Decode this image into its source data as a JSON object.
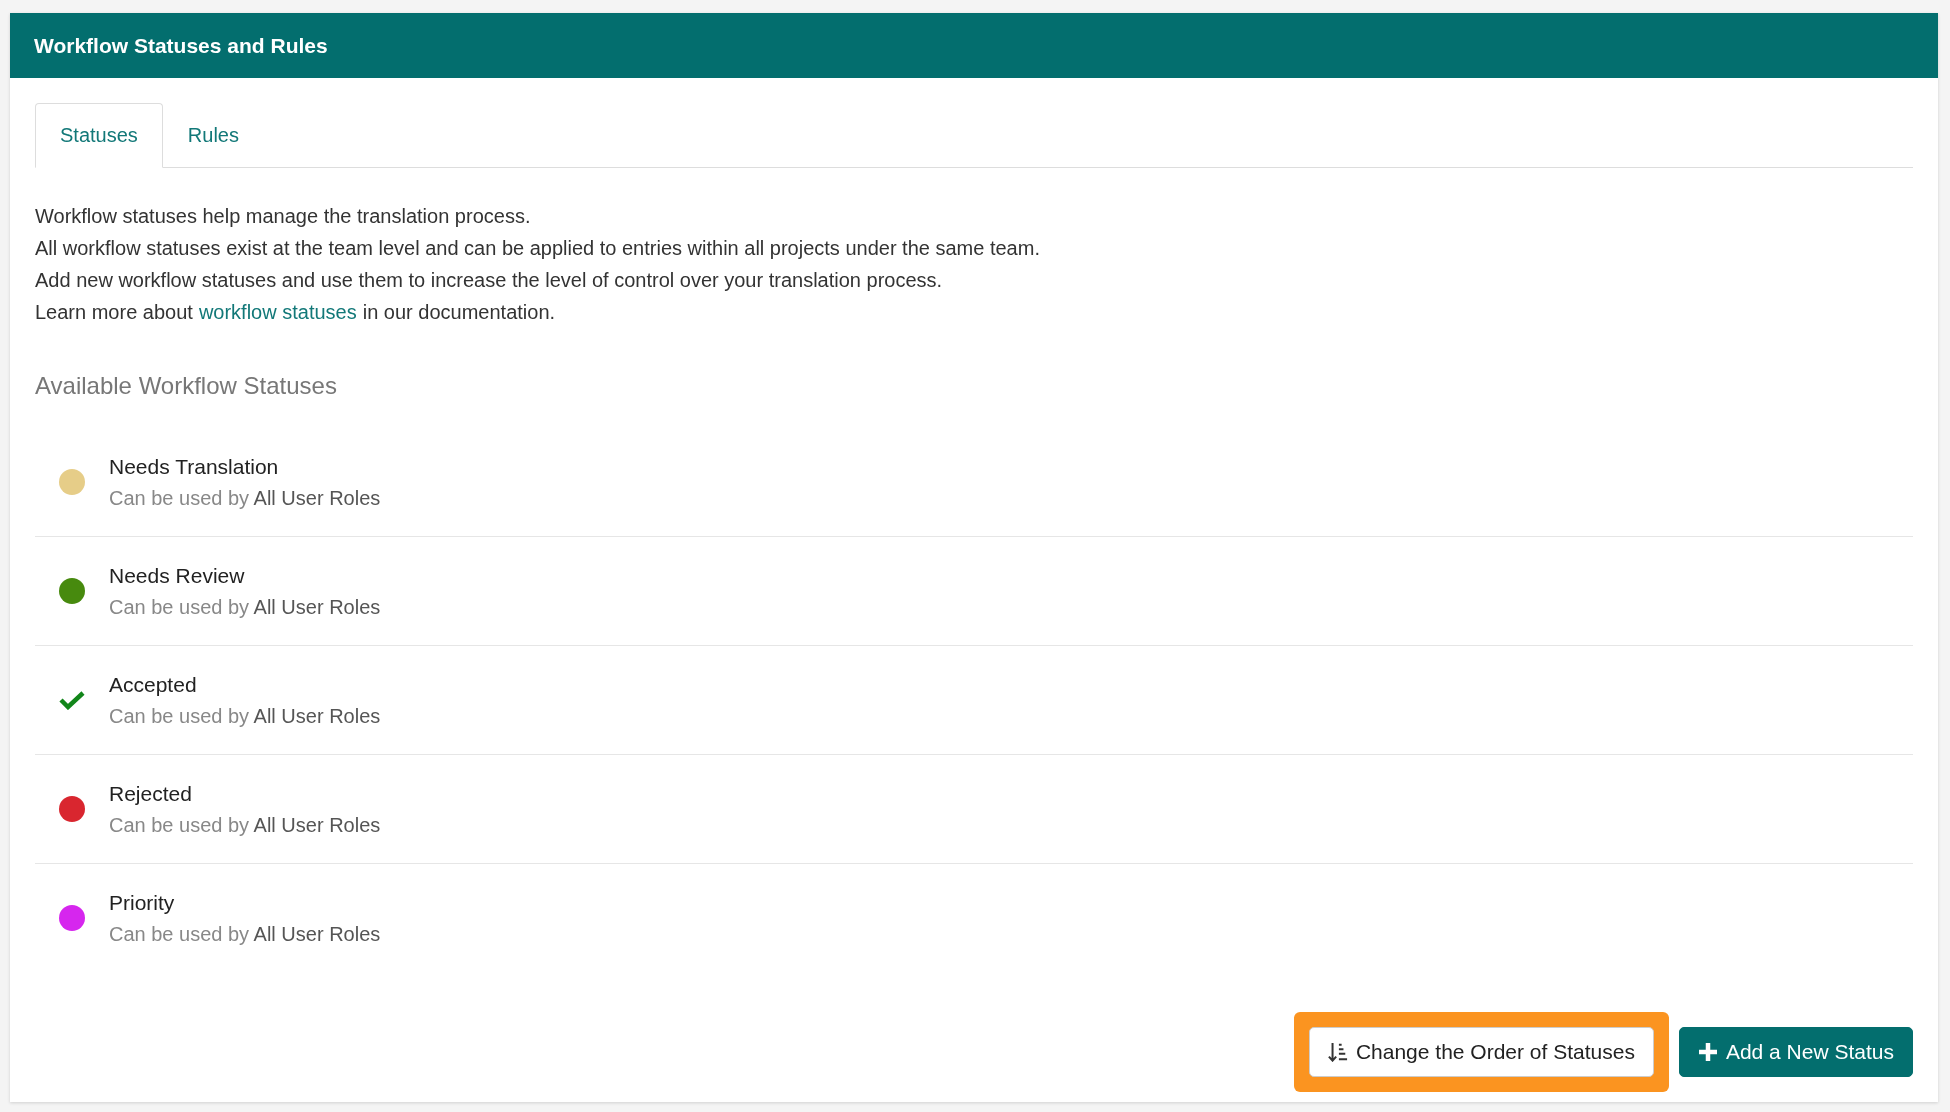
{
  "panel": {
    "title": "Workflow Statuses and Rules"
  },
  "tabs": [
    {
      "label": "Statuses",
      "selected": true
    },
    {
      "label": "Rules",
      "selected": false
    }
  ],
  "intro": [
    "Workflow statuses help manage the translation process.",
    "All workflow statuses exist at the team level and can be applied to entries within all projects under the same team.",
    "Add new workflow statuses and use them to increase the level of control over your translation process."
  ],
  "learn_more": {
    "before": "Learn more about",
    "link": "workflow statuses",
    "after": "in our documentation."
  },
  "section_title": "Available Workflow Statuses",
  "statuses": [
    {
      "name": "Needs Translation",
      "kind": "dot",
      "color": "#e6cd88",
      "usage": "Can be used by **All User Roles**"
    },
    {
      "name": "Needs Review",
      "kind": "dot",
      "color": "#478a0e",
      "usage": "Can be used by **All User Roles**"
    },
    {
      "name": "Accepted",
      "kind": "check",
      "color": "#12861a",
      "usage": "Can be used by **All User Roles**"
    },
    {
      "name": "Rejected",
      "kind": "dot",
      "color": "#d9262f",
      "usage": "Can be used by **All User Roles**"
    },
    {
      "name": "Priority",
      "kind": "dot",
      "color": "#d626ee",
      "usage": "Can be used by **All User Roles**"
    }
  ],
  "buttons": [
    {
      "label": "Change the Order of Statuses",
      "kind": "order",
      "highlighted": true
    },
    {
      "label": "Add a New Status",
      "kind": "add",
      "highlighted": false
    }
  ]
}
